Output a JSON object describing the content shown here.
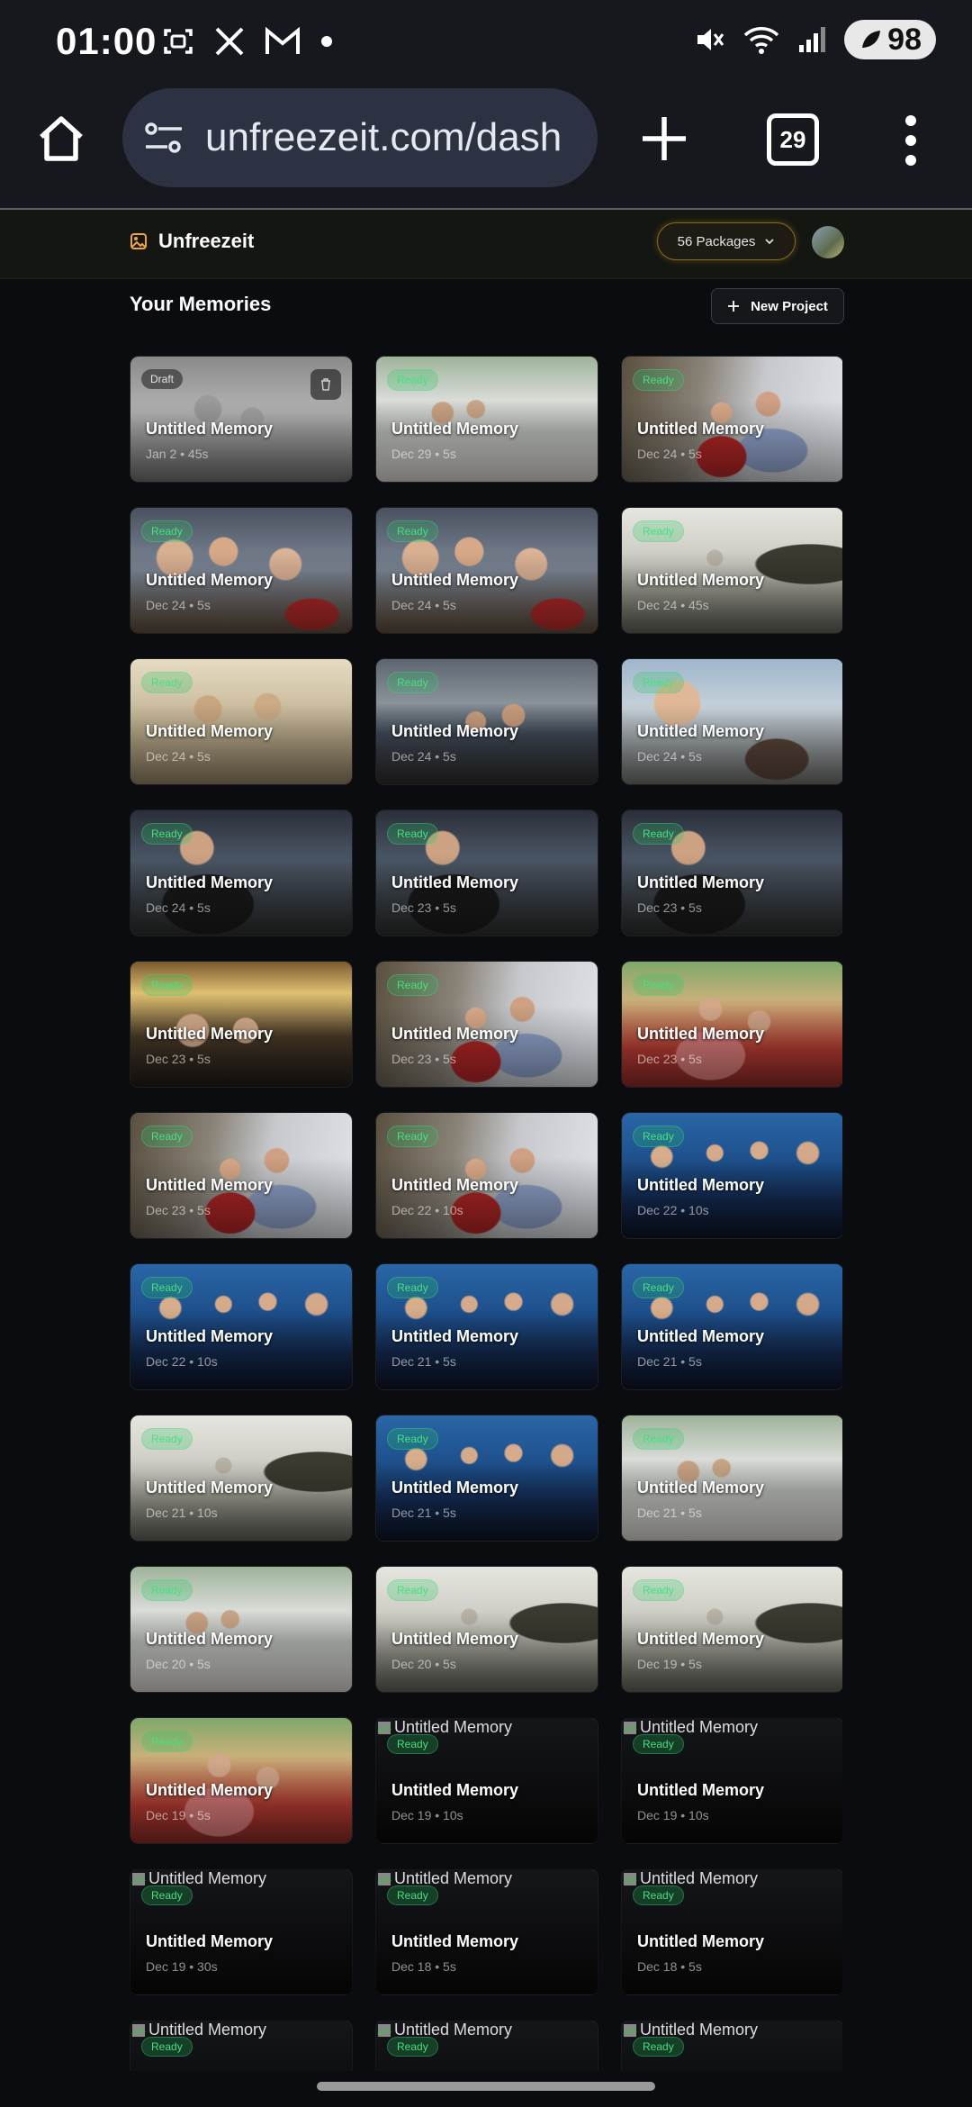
{
  "status_bar": {
    "time": "01:00",
    "battery": "98"
  },
  "browser": {
    "url": "unfreezeit.com/dash",
    "tab_count": "29"
  },
  "app": {
    "brand": "Unfreezeit",
    "packages_label": "56 Packages",
    "section_title": "Your Memories",
    "new_project_label": "New Project"
  },
  "cards": [
    {
      "title": "Untitled Memory",
      "meta": "Jan 2 • 45s",
      "badge": "Draft",
      "photo": "p7"
    },
    {
      "title": "Untitled Memory",
      "meta": "Dec 29 • 5s",
      "badge": "Ready",
      "photo": "p2"
    },
    {
      "title": "Untitled Memory",
      "meta": "Dec 24 • 5s",
      "badge": "Ready",
      "photo": "p1"
    },
    {
      "title": "Untitled Memory",
      "meta": "Dec 24 • 5s",
      "badge": "Ready",
      "photo": "p3"
    },
    {
      "title": "Untitled Memory",
      "meta": "Dec 24 • 5s",
      "badge": "Ready",
      "photo": "p3"
    },
    {
      "title": "Untitled Memory",
      "meta": "Dec 24 • 45s",
      "badge": "Ready",
      "photo": "p4"
    },
    {
      "title": "Untitled Memory",
      "meta": "Dec 24 • 5s",
      "badge": "Ready",
      "photo": "p5"
    },
    {
      "title": "Untitled Memory",
      "meta": "Dec 24 • 5s",
      "badge": "Ready",
      "photo": "p8"
    },
    {
      "title": "Untitled Memory",
      "meta": "Dec 24 • 5s",
      "badge": "Ready",
      "photo": "p9"
    },
    {
      "title": "Untitled Memory",
      "meta": "Dec 24 • 5s",
      "badge": "Ready",
      "photo": "p6"
    },
    {
      "title": "Untitled Memory",
      "meta": "Dec 23 • 5s",
      "badge": "Ready",
      "photo": "p6"
    },
    {
      "title": "Untitled Memory",
      "meta": "Dec 23 • 5s",
      "badge": "Ready",
      "photo": "p6"
    },
    {
      "title": "Untitled Memory",
      "meta": "Dec 23 • 5s",
      "badge": "Ready",
      "photo": "p10"
    },
    {
      "title": "Untitled Memory",
      "meta": "Dec 23 • 5s",
      "badge": "Ready",
      "photo": "p1"
    },
    {
      "title": "Untitled Memory",
      "meta": "Dec 23 • 5s",
      "badge": "Ready",
      "photo": "p11"
    },
    {
      "title": "Untitled Memory",
      "meta": "Dec 23 • 5s",
      "badge": "Ready",
      "photo": "p1"
    },
    {
      "title": "Untitled Memory",
      "meta": "Dec 22 • 10s",
      "badge": "Ready",
      "photo": "p1"
    },
    {
      "title": "Untitled Memory",
      "meta": "Dec 22 • 10s",
      "badge": "Ready",
      "photo": "p12"
    },
    {
      "title": "Untitled Memory",
      "meta": "Dec 22 • 10s",
      "badge": "Ready",
      "photo": "p12"
    },
    {
      "title": "Untitled Memory",
      "meta": "Dec 21 • 5s",
      "badge": "Ready",
      "photo": "p12"
    },
    {
      "title": "Untitled Memory",
      "meta": "Dec 21 • 5s",
      "badge": "Ready",
      "photo": "p12"
    },
    {
      "title": "Untitled Memory",
      "meta": "Dec 21 • 10s",
      "badge": "Ready",
      "photo": "p4"
    },
    {
      "title": "Untitled Memory",
      "meta": "Dec 21 • 5s",
      "badge": "Ready",
      "photo": "p12"
    },
    {
      "title": "Untitled Memory",
      "meta": "Dec 21 • 5s",
      "badge": "Ready",
      "photo": "p2"
    },
    {
      "title": "Untitled Memory",
      "meta": "Dec 20 • 5s",
      "badge": "Ready",
      "photo": "p2"
    },
    {
      "title": "Untitled Memory",
      "meta": "Dec 20 • 5s",
      "badge": "Ready",
      "photo": "p4"
    },
    {
      "title": "Untitled Memory",
      "meta": "Dec 19 • 5s",
      "badge": "Ready",
      "photo": "p4"
    },
    {
      "title": "Untitled Memory",
      "meta": "Dec 19 • 5s",
      "badge": "Ready",
      "photo": "p11"
    },
    {
      "title": "Untitled Memory",
      "meta": "Dec 19 • 10s",
      "badge": "Ready",
      "broken": true,
      "alt": "Untitled Memory"
    },
    {
      "title": "Untitled Memory",
      "meta": "Dec 19 • 10s",
      "badge": "Ready",
      "broken": true,
      "alt": "Untitled Memory"
    },
    {
      "title": "Untitled Memory",
      "meta": "Dec 19 • 30s",
      "badge": "Ready",
      "broken": true,
      "alt": "Untitled Memory"
    },
    {
      "title": "Untitled Memory",
      "meta": "Dec 18 • 5s",
      "badge": "Ready",
      "broken": true,
      "alt": "Untitled Memory"
    },
    {
      "title": "Untitled Memory",
      "meta": "Dec 18 • 5s",
      "badge": "Ready",
      "broken": true,
      "alt": "Untitled Memory"
    },
    {
      "title": "Untitled Memory",
      "meta": "",
      "badge": "Ready",
      "broken": true,
      "alt": "Untitled Memory"
    },
    {
      "title": "Untitled Memory",
      "meta": "",
      "badge": "Ready",
      "broken": true,
      "alt": "Untitled Memory"
    },
    {
      "title": "Untitled Memory",
      "meta": "",
      "badge": "Ready",
      "broken": true,
      "alt": "Untitled Memory"
    }
  ],
  "photo_styles": {
    "p1": "radial-gradient(ellipse at 45% 80%, #b02525 0 14%, transparent 15%), radial-gradient(ellipse at 68% 75%, #8ea0c8 0 16%, transparent 17%), radial-gradient(circle at 45% 45%, #d8a888 0 7%, transparent 8%), radial-gradient(circle at 66% 38%, #cfa083 0 7%, transparent 8%), linear-gradient(100deg, #5a5040 0%, #8a8378 35%, #c6c8cc 60%, #dfe3e8 100%)",
    "p2": "radial-gradient(circle at 30% 45%, #c9a283 0 6%, transparent 7%), radial-gradient(circle at 45% 42%, #caa587 0 6%, transparent 7%), linear-gradient(180deg, #9fb39a 0%, #d9dcd8 35%, #b8bbb6 60%, #d8d5cf 100%)",
    "p3": "radial-gradient(circle at 20% 40%, #d9b092 0 9%, transparent 10%), radial-gradient(circle at 42% 35%, #d6a989 0 9%, transparent 10%), radial-gradient(circle at 70% 45%, #dcb396 0 9%, transparent 10%), radial-gradient(ellipse at 82% 85%, #b52a2a 0 10%, transparent 11%), linear-gradient(180deg, #4a5260 0%, #7d8796 50%, #5c4a3a 100%)",
    "p4": "radial-gradient(ellipse at 85% 45%, #3a3a30 0 20%, transparent 21%), radial-gradient(circle at 42% 40%, #b9b2a6 0 5%, transparent 6%), linear-gradient(180deg, #e6e6e0 0%, #c9c9c0 45%, #8d8d84 75%, #5e5e56 100%)",
    "p5": "radial-gradient(circle at 35% 40%, #c9a680 0 8%, transparent 9%), radial-gradient(circle at 62% 38%, #ccab86 0 8%, transparent 9%), linear-gradient(180deg, #e6dcc4 0%, #c7b898 45%, #8f7f63 100%)",
    "p6": "radial-gradient(ellipse at 35% 75%, #1a1a1a 0 22%, transparent 23%), radial-gradient(circle at 30% 30%, #cda283 0 9%, transparent 10%), linear-gradient(180deg, #2a2f3a 0%, #4b5766 40%, #2b2b2b 100%)",
    "p7": "radial-gradient(circle at 35% 42%, #9a9a9a 0 8%, transparent 9%), radial-gradient(circle at 55% 50%, #a0a0a0 0 8%, transparent 9%), linear-gradient(180deg, #8a8a8a 0%, #b4b4b4 45%, #6e6e6e 100%)",
    "p8": "radial-gradient(circle at 45% 50%, #c89e80 0 7%, transparent 8%), radial-gradient(circle at 62% 45%, #c79c7e 0 7%, transparent 8%), linear-gradient(180deg, #5d6670 0%, #8a929a 35%, #3f4b58 60%, #2d2a28 100%)",
    "p9": "radial-gradient(circle at 25% 35%, #e0b898 0 12%, transparent 13%), radial-gradient(ellipse at 70% 80%, #58443a 0 14%, transparent 15%), linear-gradient(180deg, #9fb6cc 0%, #c7d2da 40%, #6c6c6a 100%)",
    "p10": "radial-gradient(circle at 28% 55%, #d2a98a 0 9%, transparent 10%), radial-gradient(circle at 52% 55%, #d4ab8c 0 9%, transparent 10%), linear-gradient(180deg, #7a5a30 0%, #e0c070 25%, #4a3a28 60%, #1e1a16 100%)",
    "p11": "radial-gradient(ellipse at 40% 75%, #d87a78 0 18%, transparent 19%), radial-gradient(circle at 40% 38%, #d2a78a 0 7%, transparent 8%), radial-gradient(circle at 62% 48%, #cfa386 0 7%, transparent 8%), linear-gradient(180deg, #7fa86a 0%, #c7b07a 30%, #b73a32 70%, #8a2a26 100%)",
    "p12": "radial-gradient(circle at 18% 35%, #d7ad8c 0 5%, transparent 6%), radial-gradient(circle at 42% 32%, #d4aa8a 0 5%, transparent 6%), radial-gradient(circle at 62% 30%, #d5ab8b 0 5%, transparent 6%), radial-gradient(circle at 84% 32%, #d4a98a 0 5%, transparent 6%), linear-gradient(180deg, #2a66a8 0%, #1d4f8a 40%, #142a50 70%, #0d1324 100%)"
  }
}
